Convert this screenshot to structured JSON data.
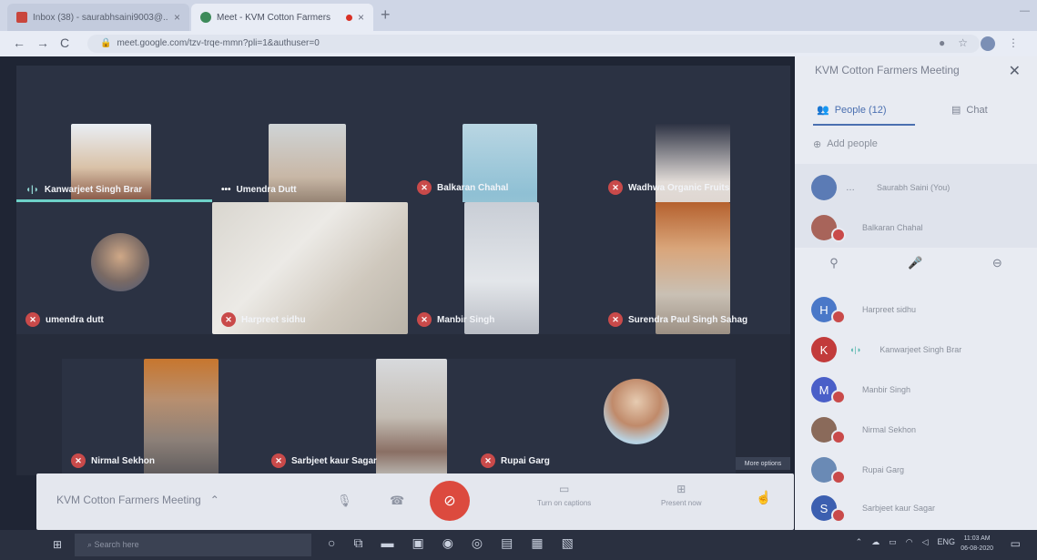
{
  "browser": {
    "tabs": [
      {
        "title": "Inbox (38) - saurabhsaini9003@...",
        "icon": "gmail-icon"
      },
      {
        "title": "Meet - KVM Cotton Farmers",
        "icon": "meet-icon"
      }
    ],
    "url": "meet.google.com/tzv-trqe-mmn?pli=1&authuser=0"
  },
  "meet": {
    "tiles": [
      {
        "name": "Kanwarjeet Singh Brar",
        "status": "speaking"
      },
      {
        "name": "Umendra Dutt",
        "status": "more"
      },
      {
        "name": "Balkaran Chahal",
        "status": "muted"
      },
      {
        "name": "Wadhwa Organic Fruits",
        "status": "muted"
      },
      {
        "name": "umendra dutt",
        "status": "muted"
      },
      {
        "name": "Harpreet sidhu",
        "status": "muted"
      },
      {
        "name": "Manbir Singh",
        "status": "muted"
      },
      {
        "name": "Surendra Paul Singh Sahag",
        "status": "muted"
      },
      {
        "name": "Nirmal Sekhon",
        "status": "muted"
      },
      {
        "name": "Sarbjeet kaur Sagar",
        "status": "muted"
      },
      {
        "name": "Rupai Garg",
        "status": "muted"
      }
    ],
    "more_options": "More options",
    "controls": {
      "meeting_name": "KVM Cotton Farmers Meeting",
      "captions": "Turn on captions",
      "present": "Present now"
    }
  },
  "panel": {
    "title": "KVM Cotton Farmers Meeting",
    "people_tab": "People (12)",
    "chat_tab": "Chat",
    "add_people": "Add people",
    "participants": [
      {
        "initial": "",
        "name": "Saurabh Saini (You)",
        "color": "#5b7bb5"
      },
      {
        "initial": "",
        "name": "Balkaran Chahal",
        "color": "#a8645a"
      },
      {
        "initial": "H",
        "name": "Harpreet sidhu",
        "color": "#4a78c8"
      },
      {
        "initial": "K",
        "name": "Kanwarjeet Singh Brar",
        "color": "#c23b3b"
      },
      {
        "initial": "M",
        "name": "Manbir Singh",
        "color": "#4a5fc8"
      },
      {
        "initial": "",
        "name": "Nirmal Sekhon",
        "color": "#8a6a5a"
      },
      {
        "initial": "",
        "name": "Rupai Garg",
        "color": "#6a8ab5"
      },
      {
        "initial": "S",
        "name": "Sarbjeet kaur Sagar",
        "color": "#3c5fb0"
      }
    ]
  },
  "taskbar": {
    "search": "Search here",
    "language": "ENG",
    "time": "11:03 AM",
    "date": "06-08-2020"
  }
}
